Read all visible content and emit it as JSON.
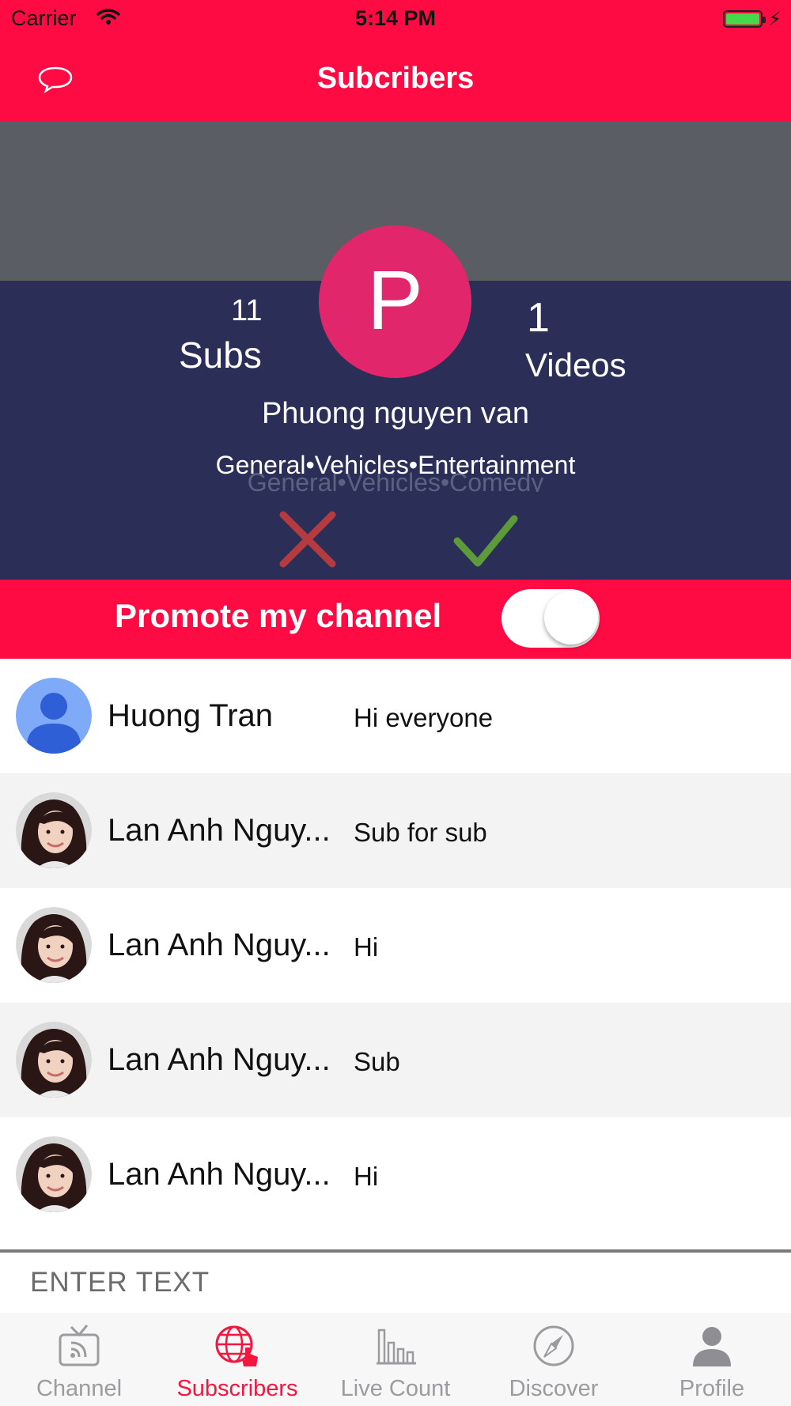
{
  "status_bar": {
    "carrier": "Carrier",
    "time": "5:14 PM"
  },
  "nav": {
    "title": "Subcribers"
  },
  "channel": {
    "avatar_letter": "P",
    "subs_count": "11",
    "subs_label": "Subs",
    "videos_count": "1",
    "videos_label": "Videos",
    "name": "Phuong nguyen van",
    "categories": "General•Vehicles•Entertainment",
    "categories_behind": "General•Vehicles•Comedy"
  },
  "promote": {
    "label": "Promote my channel",
    "enabled": true
  },
  "comments": [
    {
      "name": "Huong Tran",
      "message": "Hi everyone",
      "avatar": "default-user-icon"
    },
    {
      "name": "Lan Anh Nguy...",
      "message": "Sub for sub",
      "avatar": "user-photo"
    },
    {
      "name": "Lan Anh Nguy...",
      "message": "Hi",
      "avatar": "user-photo"
    },
    {
      "name": "Lan Anh Nguy...",
      "message": "Sub",
      "avatar": "user-photo"
    },
    {
      "name": "Lan Anh Nguy...",
      "message": "Hi",
      "avatar": "user-photo"
    }
  ],
  "input": {
    "placeholder": "ENTER TEXT",
    "value": ""
  },
  "tabs": [
    {
      "label": "Channel",
      "icon": "tv-icon",
      "active": false
    },
    {
      "label": "Subscribers",
      "icon": "globe-hand-icon",
      "active": true
    },
    {
      "label": "Live Count",
      "icon": "bar-chart-icon",
      "active": false
    },
    {
      "label": "Discover",
      "icon": "compass-icon",
      "active": false
    },
    {
      "label": "Profile",
      "icon": "person-icon",
      "active": false
    }
  ],
  "colors": {
    "brand_red": "#fe0b44",
    "header_gray": "#5a5d63",
    "header_navy": "#2b2f58",
    "avatar_pink": "#e2266b",
    "reject_red": "#b43b3f",
    "accept_green": "#5c9a3a",
    "tab_active": "#f2173f",
    "tab_inactive": "#9b9ba0"
  }
}
